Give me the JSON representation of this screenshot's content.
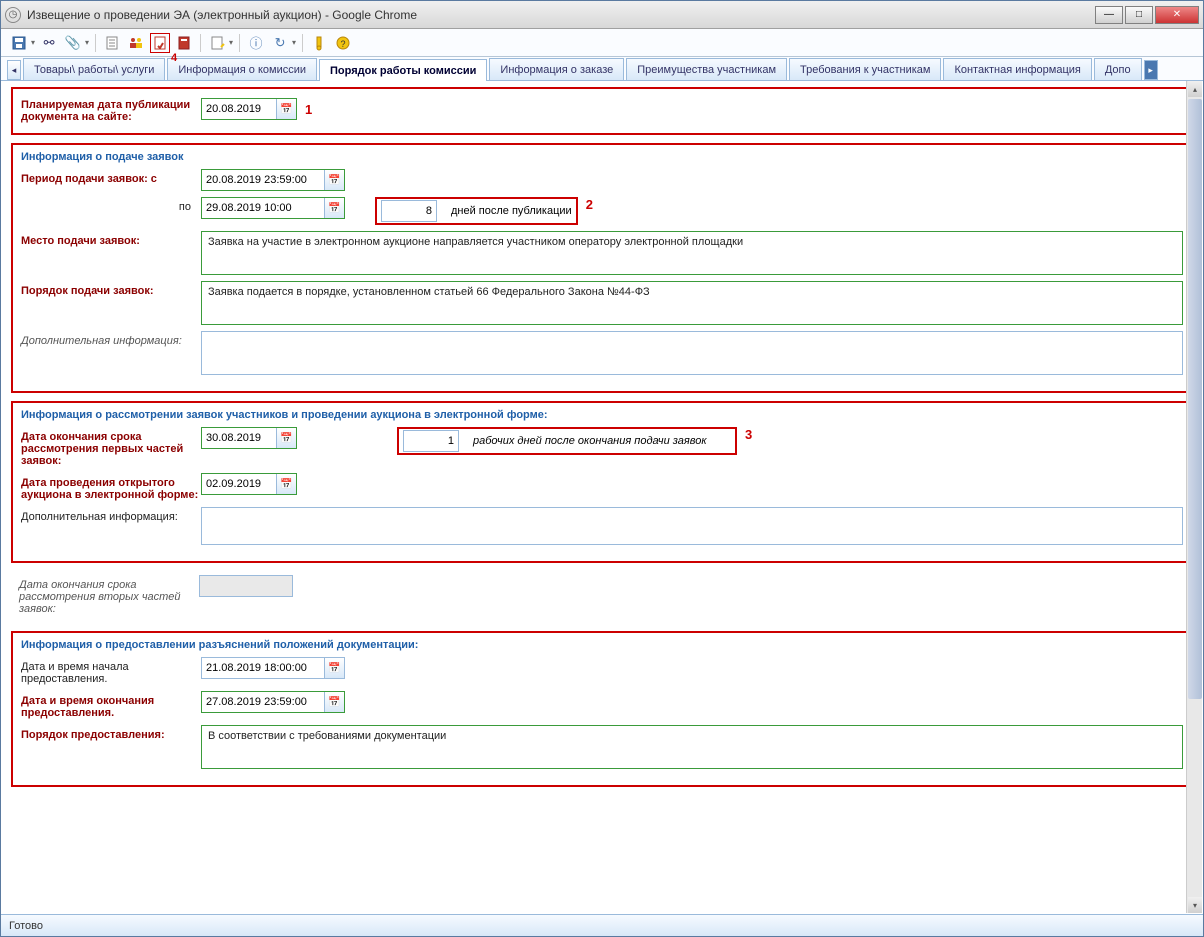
{
  "window": {
    "title": "Извещение о проведении ЭА (электронный аукцион) - Google Chrome"
  },
  "tabs": [
    "Товары\\ работы\\ услуги",
    "Информация о комиссии",
    "Порядок работы комиссии",
    "Информация о заказе",
    "Преимущества участникам",
    "Требования к участникам",
    "Контактная информация",
    "Допо"
  ],
  "annotations": {
    "a1": "1",
    "a2": "2",
    "a3": "3",
    "a4": "4"
  },
  "pubdate": {
    "label": "Планируемая дата публикации документа на сайте:",
    "value": "20.08.2019"
  },
  "section1": {
    "title": "Информация о подаче заявок",
    "period_label": "Период подачи заявок: с",
    "period_from": "20.08.2019 23:59:00",
    "period_to_label": "по",
    "period_to": "29.08.2019 10:00",
    "days_value": "8",
    "days_label": "дней после публикации",
    "place_label": "Место подачи заявок:",
    "place_value": "Заявка на участие в электронном аукционе направляется участником оператору электронной площадки",
    "order_label": "Порядок подачи заявок:",
    "order_value": "Заявка подается в порядке, установленном статьей 66 Федерального Закона №44-ФЗ",
    "addinfo_label": "Дополнительная информация:",
    "addinfo_value": ""
  },
  "section2": {
    "title": "Информация о рассмотрении заявок участников и проведении аукциона в электронной форме:",
    "enddate_label": "Дата окончания срока рассмотрения первых частей заявок:",
    "enddate_value": "30.08.2019",
    "workdays_value": "1",
    "workdays_label": "рабочих дней после окончания подачи заявок",
    "auction_label": "Дата проведения открытого аукциона в электронной форме:",
    "auction_value": "02.09.2019",
    "addinfo_label": "Дополнительная информация:",
    "addinfo_value": ""
  },
  "section2b": {
    "second_parts_label": "Дата окончания срока рассмотрения вторых частей заявок:",
    "second_parts_value": ""
  },
  "section3": {
    "title": "Информация о предоставлении разъяснений положений документации:",
    "start_label": "Дата и время начала предоставления.",
    "start_value": "21.08.2019 18:00:00",
    "end_label": "Дата и время окончания предоставления.",
    "end_value": "27.08.2019 23:59:00",
    "order_label": "Порядок предоставления:",
    "order_value": "В соответствии с требованиями документации"
  },
  "status": "Готово"
}
